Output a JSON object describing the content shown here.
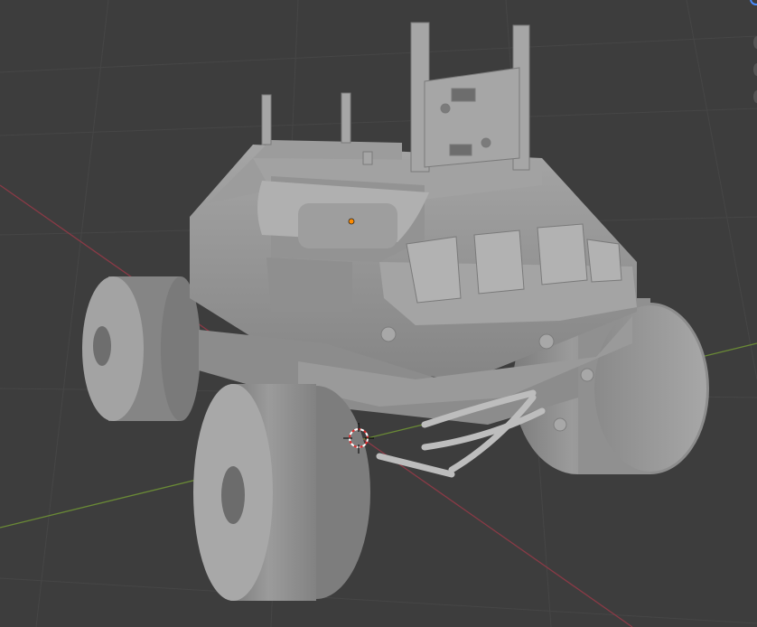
{
  "viewport": {
    "background": "#3d3d3d",
    "grid_color": "#464646",
    "x_axis_color": "#8a3a46",
    "y_axis_color": "#6a8a36",
    "object_color": "#9a9a9a",
    "origin_color": "#ff8c00",
    "cursor_color": "#ffffff",
    "gizmo_accent": "#4a8cff"
  },
  "object": {
    "icon": "rover-model-icon"
  },
  "cursor": {
    "icon": "3d-cursor-icon"
  },
  "gizmo": {
    "icon": "navigation-gizmo-icon"
  }
}
